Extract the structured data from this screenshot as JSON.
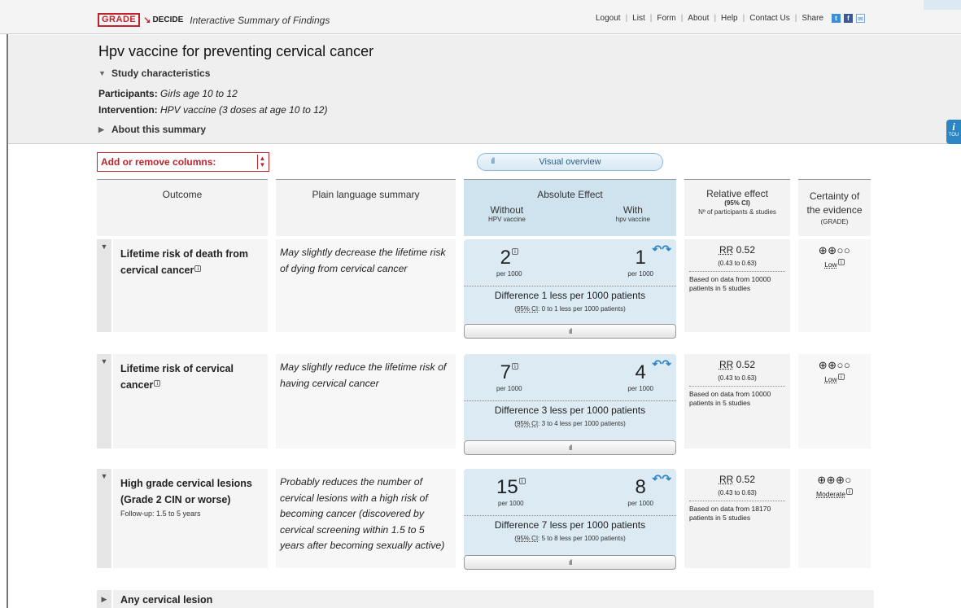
{
  "app": {
    "logo_grade": "GRADE",
    "logo_decide": "DECIDE",
    "subtitle": "Interactive Summary of Findings"
  },
  "nav": {
    "logout": "Logout",
    "list": "List",
    "form": "Form",
    "about": "About",
    "help": "Help",
    "contact": "Contact Us",
    "share": "Share"
  },
  "summary": {
    "title": "Hpv vaccine for preventing cervical cancer",
    "study_characteristics": "Study characteristics",
    "participants_label": "Participants:",
    "participants_value": "Girls age 10 to 12",
    "intervention_label": "Intervention:",
    "intervention_value": "HPV vaccine (3 doses at age 10 to 12)",
    "about": "About this summary",
    "tour_label": "TOU"
  },
  "controls": {
    "columns_select": "Add or remove columns:",
    "visual_overview": "Visual overview"
  },
  "headers": {
    "outcome": "Outcome",
    "plain": "Plain language summary",
    "absolute": "Absolute Effect",
    "without": "Without",
    "without_sub": "HPV vaccine",
    "with": "With",
    "with_sub": "hpv vaccine",
    "relative": "Relative effect",
    "relative_ci": "(95% CI)",
    "relative_participants": "Nº of participants & studies",
    "certainty_line1": "Certainty of",
    "certainty_line2": "the evidence",
    "certainty_grade": "(GRADE)"
  },
  "outcomes": [
    {
      "name": "Lifetime risk of death from cervical cancer",
      "followup": "",
      "plain": "May slightly decrease the lifetime risk of dying from cervical cancer",
      "without": "2",
      "with": "1",
      "per": "per 1000",
      "difference": "Difference 1 less per 1000 patients",
      "ci_label": "95% CI",
      "ci_text": ": 0 to 1 less per 1000 patients)",
      "rr": "0.52",
      "rr_label": "RR",
      "rr_ci": "(0.43 to 0.63)",
      "rr_note": "Based on data from 10000 patients in 5 studies",
      "certainty_symbols": "⊕⊕○○",
      "certainty": "Low"
    },
    {
      "name": "Lifetime risk of cervical cancer",
      "followup": "",
      "plain": "May slightly reduce the lifetime risk of having cervical cancer",
      "without": "7",
      "with": "4",
      "per": "per 1000",
      "difference": "Difference 3 less per 1000 patients",
      "ci_label": "95% CI",
      "ci_text": ": 3 to 4 less per 1000 patients)",
      "rr": "0.52",
      "rr_label": "RR",
      "rr_ci": "(0.43 to 0.63)",
      "rr_note": "Based on data from 10000 patients in 5 studies",
      "certainty_symbols": "⊕⊕○○",
      "certainty": "Low"
    },
    {
      "name": "High grade cervical lesions (Grade 2 CIN or worse)",
      "followup": "Follow-up: 1.5 to 5 years",
      "plain": "Probably reduces the number of cervical lesions with a high risk of becoming cancer (discovered by cervical screening within 1.5 to 5 years after becoming sexually active)",
      "without": "15",
      "with": "8",
      "per": "per 1000",
      "difference": "Difference 7 less per 1000 patients",
      "ci_label": "95% CI",
      "ci_text": ": 5 to 8 less per 1000 patients)",
      "rr": "0.52",
      "rr_label": "RR",
      "rr_ci": "(0.43 to 0.63)",
      "rr_note": "Based on data from 18170 patients in 5 studies",
      "certainty_symbols": "⊕⊕⊕○",
      "certainty": "Moderate"
    }
  ],
  "collapsed_outcome": "Any cervical lesion"
}
